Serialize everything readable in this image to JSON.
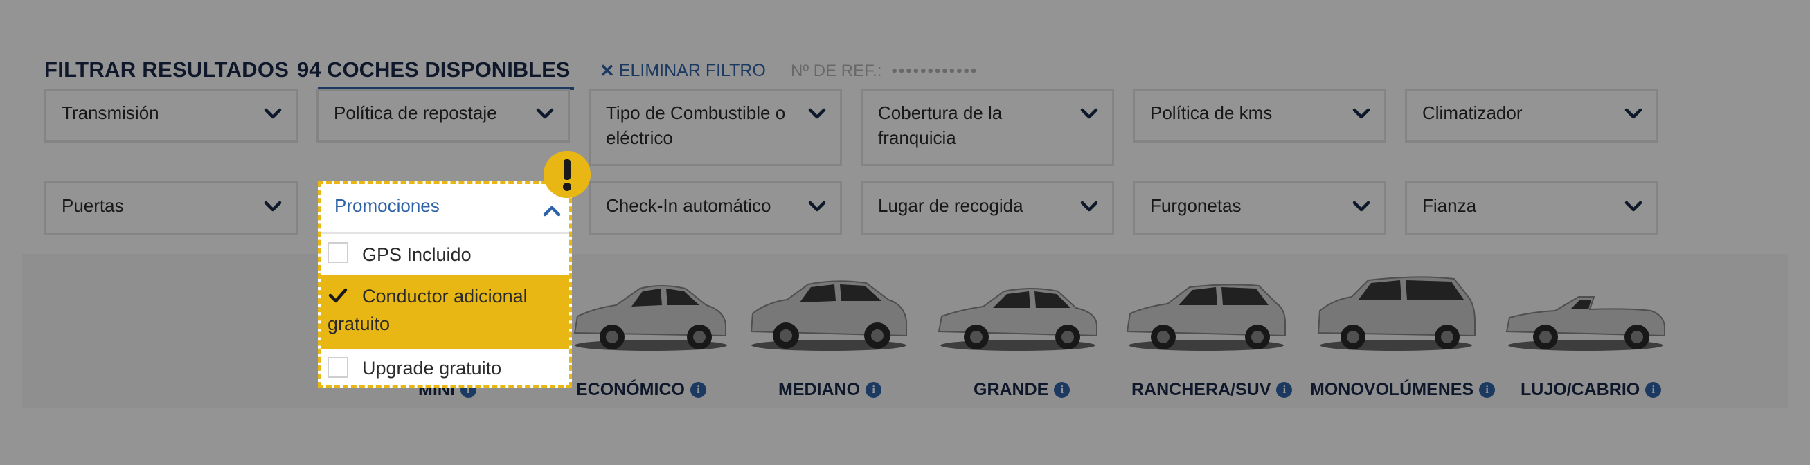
{
  "header": {
    "title": "FILTRAR RESULTADOS",
    "count": "94 COCHES DISPONIBLES",
    "remove_filter": "ELIMINAR FILTRO",
    "ref_label": "Nº DE REF.:",
    "ref_value": "••••••••••••"
  },
  "filters": {
    "row1": [
      {
        "label": "Transmisión"
      },
      {
        "label": "Política de repostaje"
      },
      {
        "label": "Tipo de Combustible o eléctrico"
      },
      {
        "label": "Cobertura de la franquicia"
      },
      {
        "label": "Política de kms"
      },
      {
        "label": "Climatizador"
      }
    ],
    "row2": [
      {
        "label": "Puertas"
      },
      {
        "label": "Promociones"
      },
      {
        "label": "Check-In automático"
      },
      {
        "label": "Lugar de recogida"
      },
      {
        "label": "Furgonetas"
      },
      {
        "label": "Fianza"
      }
    ]
  },
  "promotions": {
    "label": "Promociones",
    "options": [
      {
        "label": "GPS Incluido",
        "checked": false
      },
      {
        "label": "Conductor adicional gratuito",
        "checked": true
      },
      {
        "label": "Upgrade gratuito",
        "checked": false
      }
    ]
  },
  "categories": [
    {
      "label": "MINI"
    },
    {
      "label": "ECONÓMICO"
    },
    {
      "label": "MEDIANO"
    },
    {
      "label": "GRANDE"
    },
    {
      "label": "RANCHERA/SUV"
    },
    {
      "label": "MONOVOLÚMENES"
    },
    {
      "label": "LUJO/CABRIO"
    }
  ],
  "icons": {
    "chevron": "chevron-down-icon",
    "info": "info-icon",
    "remove": "close-icon",
    "warning": "warning-icon",
    "check": "check-icon"
  },
  "colors": {
    "accent": "#2f63a8",
    "highlight": "#e9b714",
    "text_dark": "#1a2a4a"
  }
}
